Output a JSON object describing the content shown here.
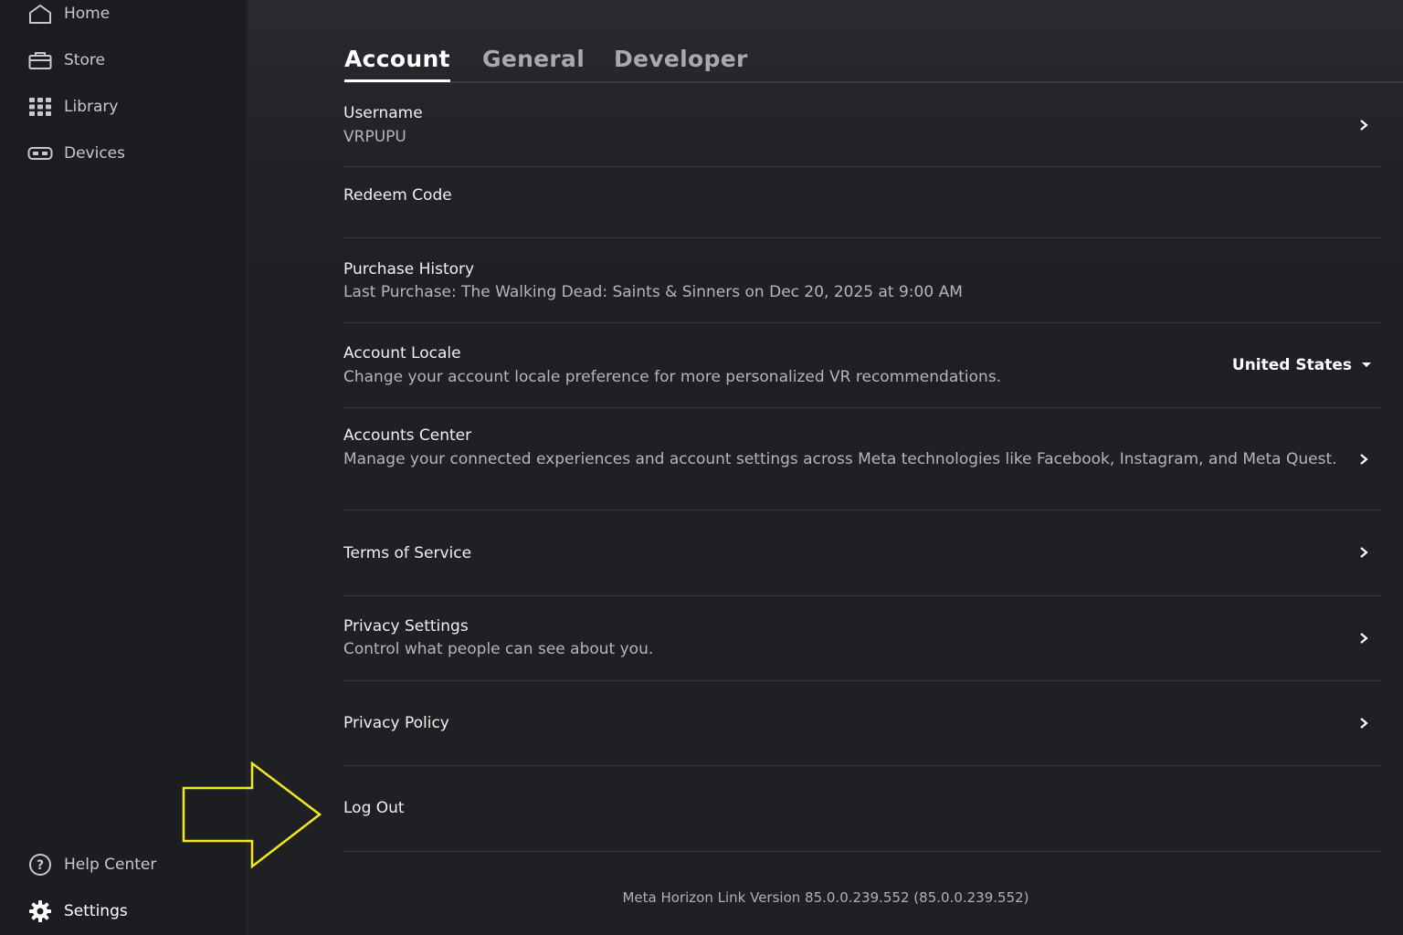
{
  "sidebar": {
    "items": [
      {
        "label": "Home",
        "icon": "home-icon"
      },
      {
        "label": "Store",
        "icon": "store-icon"
      },
      {
        "label": "Library",
        "icon": "library-grid-icon"
      },
      {
        "label": "Devices",
        "icon": "headset-icon"
      }
    ],
    "help_label": "Help Center",
    "settings_label": "Settings"
  },
  "tabs": [
    {
      "label": "Account",
      "active": true
    },
    {
      "label": "General",
      "active": false
    },
    {
      "label": "Developer",
      "active": false
    }
  ],
  "account": {
    "username": {
      "title": "Username",
      "value": "VRPUPU"
    },
    "redeem": {
      "title": "Redeem Code"
    },
    "purchase": {
      "title": "Purchase History",
      "sub": "Last Purchase: The Walking Dead: Saints & Sinners on Dec 20, 2025 at 9:00 AM"
    },
    "locale": {
      "title": "Account Locale",
      "sub": "Change your account locale preference for more personalized VR recommendations.",
      "selected": "United States"
    },
    "accounts_center": {
      "title": "Accounts Center",
      "sub": "Manage your connected experiences and account settings across Meta technologies like Facebook, Instagram, and Meta Quest."
    },
    "terms": {
      "title": "Terms of Service"
    },
    "privacy_settings": {
      "title": "Privacy Settings",
      "sub": "Control what people can see about you."
    },
    "privacy_policy": {
      "title": "Privacy Policy"
    },
    "logout": {
      "title": "Log Out"
    }
  },
  "footer": {
    "version": "Meta Horizon Link Version 85.0.0.239.552 (85.0.0.239.552)"
  },
  "colors": {
    "annotation_arrow": "#f2ea1f",
    "background": "#1f2023"
  }
}
